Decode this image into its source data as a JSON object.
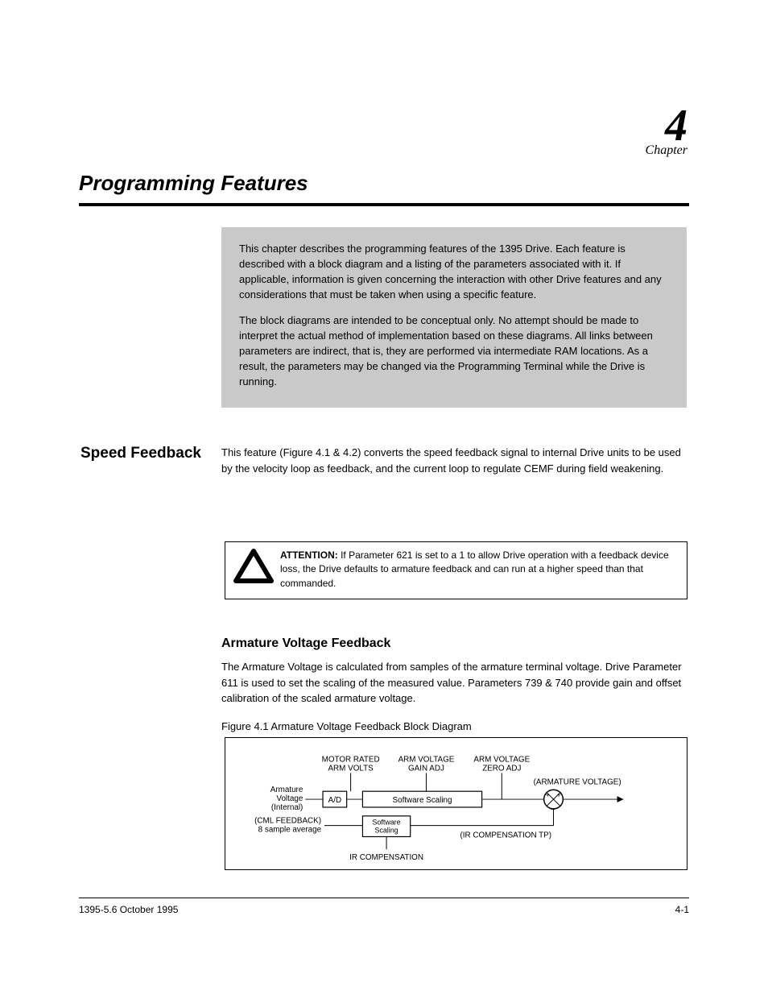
{
  "header": {
    "chapter_number": "4",
    "chapter_label": "Chapter"
  },
  "title": "Programming Features",
  "intro": {
    "p1": "This chapter describes the programming features of the 1395 Drive. Each feature is described with a block diagram and a listing of the parameters associated with it. If applicable, information is given concerning the interaction with other Drive features and any considerations that must be taken when using a specific feature.",
    "p2": "The block diagrams are intended to be conceptual only. No attempt should be made to interpret the actual method of implementation based on these diagrams. All links between parameters are indirect, that is, they are performed via intermediate RAM locations. As a result, the parameters may be changed via the Programming Terminal while the Drive is running."
  },
  "section_label": "Speed Feedback",
  "speed_feedback_para": "This feature (Figure 4.1 & 4.2) converts the speed feedback signal to internal Drive units to be used by the velocity loop as feedback, and the current loop to regulate CEMF during field weakening.",
  "caution": {
    "heading": "ATTENTION:",
    "text": "  If Parameter 621 is set to a 1 to allow Drive operation with a feedback device loss, the Drive defaults to armature feedback and can run at a higher speed than that commanded."
  },
  "sub_heading": "Armature Voltage Feedback",
  "arm_para": "The Armature Voltage is calculated from samples of the armature terminal voltage. Drive Parameter 611 is used to set the scaling of the measured value. Parameters 739 & 740 provide gain and offset calibration of the scaled armature voltage.",
  "fig_caption": "Figure 4.1 Armature Voltage Feedback Block Diagram",
  "diagram": {
    "label_motor_rated": "MOTOR RATED ARM VOLTS",
    "label_gain_adj": "ARM VOLTAGE GAIN ADJ",
    "label_zero_adj": "ARM VOLTAGE ZERO ADJ",
    "label_arm_voltage_out": "(ARMATURE VOLTAGE)",
    "label_arm_volt_in": "Armature Voltage (Internal)",
    "label_ad": "A/D",
    "label_sw_scaling": "Software Scaling",
    "label_sw_scaling2": "Software Scaling",
    "label_cml": "(CML FEEDBACK) 8 sample average",
    "label_ircomp_tp": "(IR COMPENSATION TP)",
    "label_ircomp": "IR COMPENSATION",
    "plus": "+",
    "minus": "−"
  },
  "footer": {
    "left": "1395-5.6  October 1995",
    "right": "4-1"
  }
}
